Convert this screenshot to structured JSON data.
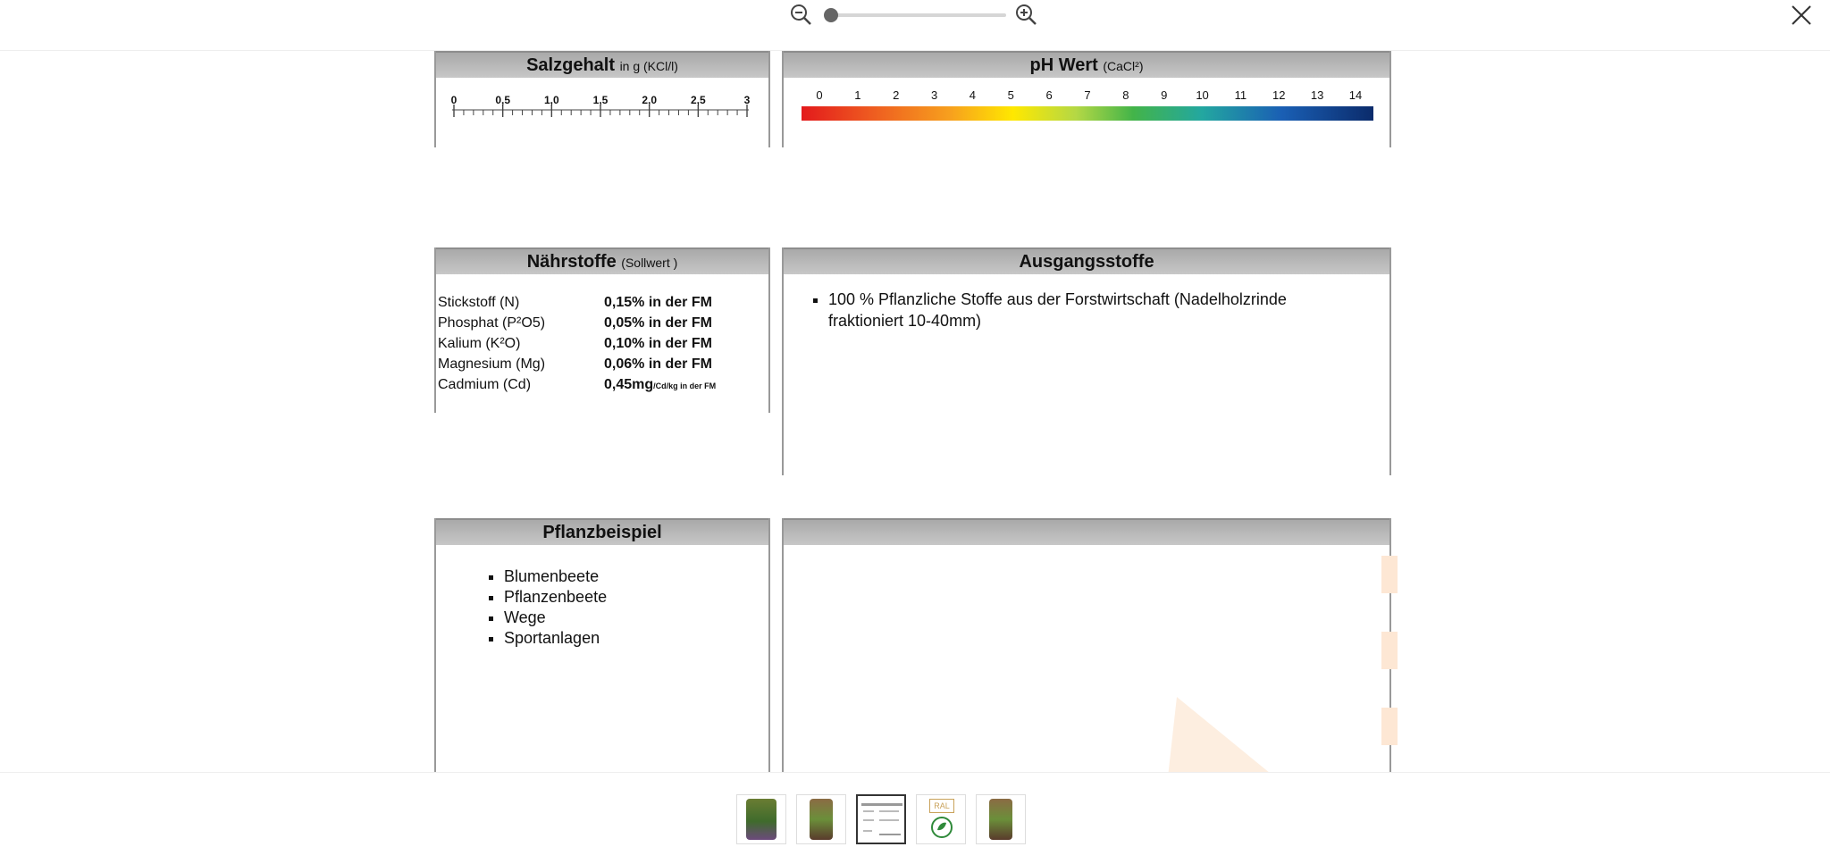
{
  "toolbar": {
    "zoom_out_icon": "zoom-out-icon",
    "zoom_in_icon": "zoom-in-icon",
    "zoom_level": 0,
    "close_icon": "close-icon"
  },
  "salzgehalt": {
    "title": "Salzgehalt",
    "unit": "in g (KCl/l)",
    "ticks": [
      "0",
      "0,5",
      "1,0",
      "1,5",
      "2,0",
      "2,5",
      "3"
    ]
  },
  "ph": {
    "title": "pH Wert",
    "unit": "(CaCl²)",
    "ticks": [
      "0",
      "1",
      "2",
      "3",
      "4",
      "5",
      "6",
      "7",
      "8",
      "9",
      "10",
      "11",
      "12",
      "13",
      "14"
    ]
  },
  "naehrstoffe": {
    "title": "Nährstoffe",
    "subtitle": "(Sollwert )",
    "rows": [
      {
        "name": "Stickstoff (N)",
        "value": "0,15% in der FM",
        "unit": ""
      },
      {
        "name": "Phosphat (P²O5)",
        "value": "0,05% in der FM",
        "unit": ""
      },
      {
        "name": "Kalium (K²O)",
        "value": "0,10% in der FM",
        "unit": ""
      },
      {
        "name": "Magnesium (Mg)",
        "value": "0,06% in der FM",
        "unit": ""
      },
      {
        "name": "Cadmium (Cd)",
        "value": "0,45mg",
        "unit": "/Cd/kg in der FM"
      }
    ]
  },
  "ausgangsstoffe": {
    "title": "Ausgangsstoffe",
    "items": [
      "100 % Pflanzliche Stoffe aus der Forstwirtschaft (Nadelholzrinde fraktioniert 10-40mm)"
    ]
  },
  "pflanzbeispiel": {
    "title": "Pflanzbeispiel",
    "items": [
      "Blumenbeete",
      "Pflanzenbeete",
      "Wege",
      "Sportanlagen"
    ]
  },
  "thumbnails": {
    "items": [
      "product-bag-thumbnail",
      "product-bag-thumbnail",
      "datasheet-thumbnail",
      "ral-certificate-thumbnail",
      "product-bag-thumbnail"
    ],
    "selected_index": 2,
    "ral_text": "RAL"
  }
}
